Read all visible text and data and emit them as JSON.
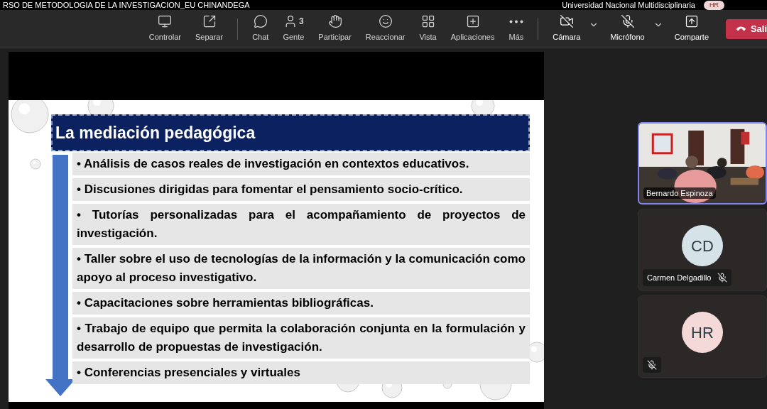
{
  "title_bar": {
    "meeting_title": "RSO DE METODOLOGIA DE LA INVESTIGACION_EU CHINANDEGA",
    "organization": "Universidad Nacional Multidisciplinaria",
    "avatar_initials": "HR"
  },
  "toolbar": {
    "groups": [
      [
        {
          "label": "Controlar"
        },
        {
          "label": "Separar"
        }
      ],
      [
        {
          "label": "Chat"
        },
        {
          "label": "Gente",
          "count": "3"
        },
        {
          "label": "Participar"
        },
        {
          "label": "Reaccionar"
        },
        {
          "label": "Vista"
        },
        {
          "label": "Aplicaciones"
        },
        {
          "label": "Más"
        }
      ],
      [
        {
          "label": "Cámara",
          "on": false
        },
        {
          "label": "Micrófono",
          "on": false
        },
        {
          "label": "Comparte"
        }
      ]
    ],
    "leave_button": "Sali"
  },
  "slide": {
    "title": "La mediación pedagógica",
    "bullets": [
      {
        "text": "• Análisis de casos reales de investigación en contextos educativos."
      },
      {
        "text": "• Discusiones dirigidas para fomentar el pensamiento socio-crítico."
      },
      {
        "text": "• Tutorías personalizadas para el acompañamiento de proyectos de investigación."
      },
      {
        "text": "• Taller sobre el uso de tecnologías de la información y la comunicación como apoyo al proceso investigativo."
      },
      {
        "text": "• Capacitaciones sobre herramientas bibliográficas."
      },
      {
        "text": "• Trabajo de equipo que permita la colaboración conjunta en la formulación y desarrollo de propuestas de investigación."
      },
      {
        "text": "• Conferencias presenciales y virtuales"
      }
    ]
  },
  "participants": [
    {
      "kind": "video",
      "name": "Bernardo Espinoza",
      "speaking": true,
      "muted": false
    },
    {
      "kind": "avatar",
      "name": "Carmen Delgadillo",
      "initials": "CD",
      "color": "#d5e3e9",
      "speaking": false,
      "muted": true
    },
    {
      "kind": "avatar",
      "initials": "HR",
      "color": "#f5d8d8",
      "speaking": false,
      "muted": true
    }
  ]
}
